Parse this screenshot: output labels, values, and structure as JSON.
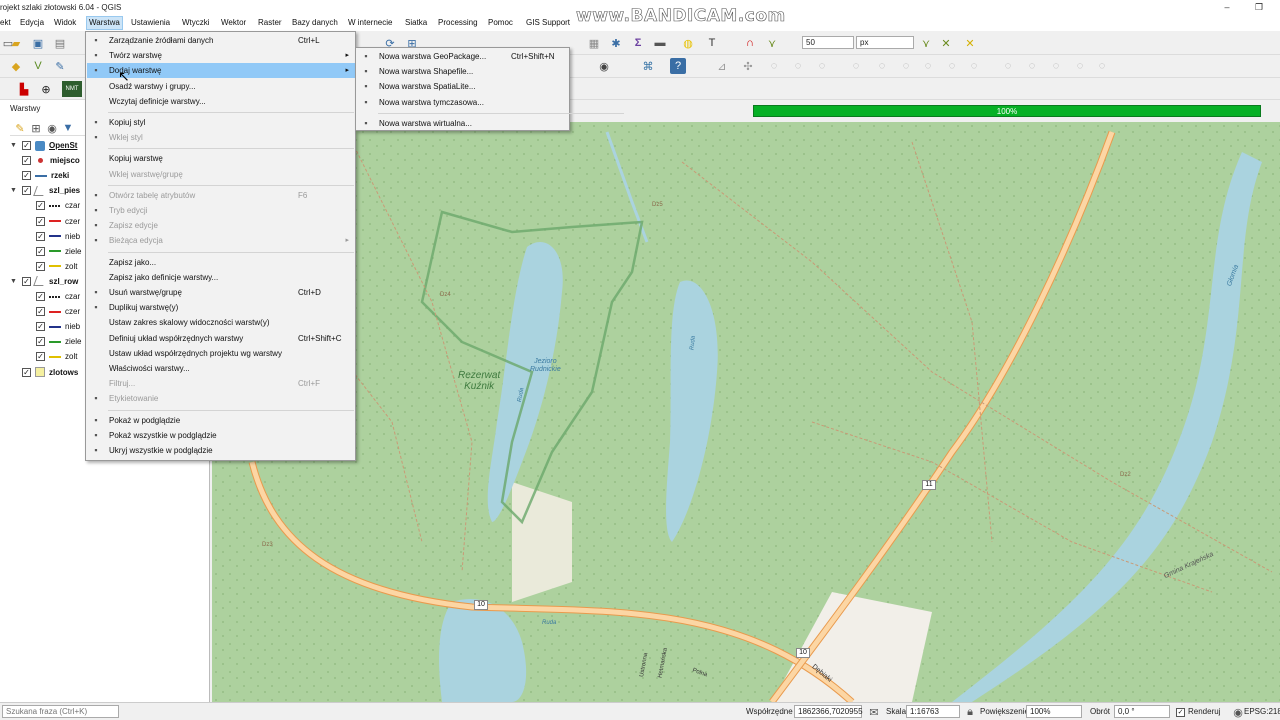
{
  "window": {
    "title": "rojekt szlaki złotowski 6.04 - QGIS",
    "minimize": "–",
    "maximize": "❐"
  },
  "watermark": "www.BANDICAM.com",
  "menubar": {
    "items": [
      "ekt",
      "Edycja",
      "Widok",
      "Warstwa",
      "Ustawienia",
      "Wtyczki",
      "Wektor",
      "Raster",
      "Bazy danych",
      "W internecie",
      "Siatka",
      "Processing",
      "Pomoc",
      "GIS Support"
    ],
    "active": "Warstwa"
  },
  "toolbar": {
    "scale_value": "50",
    "unit_value": "px",
    "nmt_label": "NMT"
  },
  "panel": {
    "title": "Warstwy",
    "layers": [
      {
        "name": "OpenSt",
        "checked": true,
        "expander": "▼",
        "bold": true,
        "symbol": "osm",
        "indent": 0
      },
      {
        "name": "miejsco",
        "checked": true,
        "expander": "",
        "bold": true,
        "symbol": "point",
        "indent": 0
      },
      {
        "name": "rzeki",
        "checked": true,
        "expander": "",
        "bold": true,
        "symbol": "line-blue",
        "indent": 0
      },
      {
        "name": "szl_pies",
        "checked": true,
        "expander": "▼",
        "bold": true,
        "symbol": "rule",
        "indent": 0
      },
      {
        "name": "czar",
        "checked": true,
        "expander": "",
        "bold": false,
        "symbol": "line-black",
        "indent": 1
      },
      {
        "name": "czer",
        "checked": true,
        "expander": "",
        "bold": false,
        "symbol": "line-red",
        "indent": 1
      },
      {
        "name": "nieb",
        "checked": true,
        "expander": "",
        "bold": false,
        "symbol": "line-navy",
        "indent": 1
      },
      {
        "name": "ziele",
        "checked": true,
        "expander": "",
        "bold": false,
        "symbol": "line-green",
        "indent": 1
      },
      {
        "name": "zolt",
        "checked": true,
        "expander": "",
        "bold": false,
        "symbol": "line-yellow",
        "indent": 1
      },
      {
        "name": "szl_row",
        "checked": true,
        "expander": "▼",
        "bold": true,
        "symbol": "rule",
        "indent": 0
      },
      {
        "name": "czar",
        "checked": true,
        "expander": "",
        "bold": false,
        "symbol": "line-black",
        "indent": 1
      },
      {
        "name": "czer",
        "checked": true,
        "expander": "",
        "bold": false,
        "symbol": "line-red",
        "indent": 1
      },
      {
        "name": "nieb",
        "checked": true,
        "expander": "",
        "bold": false,
        "symbol": "line-navy",
        "indent": 1
      },
      {
        "name": "ziele",
        "checked": true,
        "expander": "",
        "bold": false,
        "symbol": "line-green",
        "indent": 1
      },
      {
        "name": "zolt",
        "checked": true,
        "expander": "",
        "bold": false,
        "symbol": "line-yellow",
        "indent": 1
      },
      {
        "name": "zlotows",
        "checked": true,
        "expander": "",
        "bold": true,
        "symbol": "poly",
        "indent": 0
      }
    ]
  },
  "progress": {
    "label": "100%",
    "value": 1.0
  },
  "layer_menu": {
    "items": [
      {
        "label": "Zarządzanie źródłami danych",
        "shortcut": "Ctrl+L",
        "icon": "datasource-icon",
        "disabled": false
      },
      {
        "label": "Twórz warstwę",
        "shortcut": "",
        "icon": "new-layer-icon",
        "disabled": false,
        "submenu": true
      },
      {
        "label": "Dodaj warstwę",
        "shortcut": "",
        "icon": "add-layer-icon",
        "disabled": false,
        "submenu": true,
        "highlighted": true
      },
      {
        "label": "Osadź warstwy i grupy...",
        "shortcut": "",
        "icon": "",
        "disabled": false
      },
      {
        "label": "Wczytaj definicje warstwy...",
        "shortcut": "",
        "icon": "",
        "disabled": false
      },
      {
        "sep": true
      },
      {
        "label": "Kopiuj styl",
        "shortcut": "",
        "icon": "copy-style-icon",
        "disabled": false
      },
      {
        "label": "Wklej styl",
        "shortcut": "",
        "icon": "paste-style-icon",
        "disabled": true
      },
      {
        "sep": true
      },
      {
        "label": "Kopiuj warstwę",
        "shortcut": "",
        "icon": "",
        "disabled": false
      },
      {
        "label": "Wklej warstwę/grupę",
        "shortcut": "",
        "icon": "",
        "disabled": true
      },
      {
        "sep": true
      },
      {
        "label": "Otwórz tabelę atrybutów",
        "shortcut": "F6",
        "icon": "table-icon",
        "disabled": true
      },
      {
        "label": "Tryb edycji",
        "shortcut": "",
        "icon": "edit-icon",
        "disabled": true
      },
      {
        "label": "Zapisz edycje",
        "shortcut": "",
        "icon": "save-edits-icon",
        "disabled": true
      },
      {
        "label": "Bieżąca edycja",
        "shortcut": "",
        "icon": "current-edit-icon",
        "disabled": true,
        "submenu": true
      },
      {
        "sep": true
      },
      {
        "label": "Zapisz jako...",
        "shortcut": "",
        "icon": "",
        "disabled": false
      },
      {
        "label": "Zapisz jako definicje warstwy...",
        "shortcut": "",
        "icon": "",
        "disabled": false
      },
      {
        "label": "Usuń warstwę/grupę",
        "shortcut": "Ctrl+D",
        "icon": "remove-layer-icon",
        "disabled": false
      },
      {
        "label": "Duplikuj warstwę(y)",
        "shortcut": "",
        "icon": "duplicate-icon",
        "disabled": false
      },
      {
        "label": "Ustaw zakres skalowy widoczności warstw(y)",
        "shortcut": "",
        "icon": "",
        "disabled": false
      },
      {
        "label": "Definiuj układ współrzędnych warstwy",
        "shortcut": "Ctrl+Shift+C",
        "icon": "",
        "disabled": false
      },
      {
        "label": "Ustaw układ współrzędnych projektu wg warstwy",
        "shortcut": "",
        "icon": "",
        "disabled": false
      },
      {
        "label": "Właściwości warstwy...",
        "shortcut": "",
        "icon": "",
        "disabled": false
      },
      {
        "label": "Filtruj...",
        "shortcut": "Ctrl+F",
        "icon": "",
        "disabled": true
      },
      {
        "label": "Etykietowanie",
        "shortcut": "",
        "icon": "label-icon",
        "disabled": true
      },
      {
        "sep": true
      },
      {
        "label": "Pokaż w podglądzie",
        "shortcut": "",
        "icon": "overview-icon",
        "disabled": false
      },
      {
        "label": "Pokaż wszystkie w podglądzie",
        "shortcut": "",
        "icon": "overview-all-icon",
        "disabled": false
      },
      {
        "label": "Ukryj wszystkie w podglądzie",
        "shortcut": "",
        "icon": "overview-hide-icon",
        "disabled": false
      }
    ]
  },
  "add_layer_submenu": {
    "items": [
      {
        "label": "Nowa warstwa GeoPackage...",
        "shortcut": "Ctrl+Shift+N",
        "icon": "geopackage-icon"
      },
      {
        "label": "Nowa warstwa Shapefile...",
        "shortcut": "",
        "icon": "shapefile-icon"
      },
      {
        "label": "Nowa warstwa SpatiaLite...",
        "shortcut": "",
        "icon": "spatialite-icon"
      },
      {
        "label": "Nowa warstwa tymczasowa...",
        "shortcut": "",
        "icon": "temp-layer-icon"
      },
      {
        "sep": true
      },
      {
        "label": "Nowa warstwa wirtualna...",
        "shortcut": "",
        "icon": "virtual-layer-icon"
      }
    ]
  },
  "map_labels": {
    "reserve": "Rezerwat\nKuźnik",
    "lake": "Jezioro\nRudnickie",
    "road11": "11",
    "road10a": "10",
    "road10b": "10",
    "street1": "Dębiaki",
    "street2": "Ustronna",
    "street3": "Hetmańska",
    "street4": "Polna",
    "river": "Głomia",
    "rud1": "Ruda",
    "rud2": "Ruda",
    "rud3": "Ruda",
    "trail": "Gmina Krajeńska",
    "ds1": "Dz5",
    "ds2": "Dz4",
    "ds3": "Dz3",
    "ds4": "Dz2"
  },
  "statusbar": {
    "search_placeholder": "Szukana fraza (Ctrl+K)",
    "coord_label": "Współrzędne",
    "coord_value": "1862366,7020955",
    "scale_label": "Skala",
    "scale_value": "1:16763",
    "mag_label": "Powiększenie",
    "mag_value": "100%",
    "rot_label": "Obrót",
    "rot_value": "0,0 °",
    "render_label": "Renderuj",
    "crs_label": "EPSG:2180"
  },
  "colors": {
    "map_bg": "#c8dfa8",
    "water": "#aad3df",
    "road": "#f6a554",
    "highlight": "#91c9f7",
    "progress": "#06b025"
  }
}
